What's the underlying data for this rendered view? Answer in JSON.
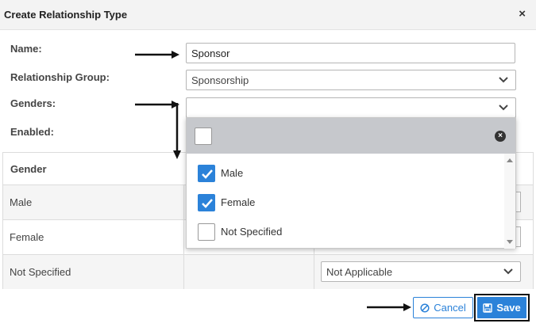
{
  "dialog": {
    "title": "Create Relationship Type",
    "close_symbol": "×"
  },
  "form": {
    "name_label": "Name:",
    "name_value": "Sponsor",
    "group_label": "Relationship Group:",
    "group_value": "Sponsorship",
    "genders_label": "Genders:",
    "genders_value": "",
    "enabled_label": "Enabled:"
  },
  "grid": {
    "header": "Gender",
    "rows": [
      {
        "gender": "Male"
      },
      {
        "gender": "Female"
      },
      {
        "gender": "Not Specified",
        "value": "Not Applicable"
      }
    ]
  },
  "dropdown": {
    "items": [
      {
        "label": "Male",
        "checked": true
      },
      {
        "label": "Female",
        "checked": true
      },
      {
        "label": "Not Specified",
        "checked": false
      }
    ]
  },
  "buttons": {
    "cancel_label": "Cancel",
    "save_label": "Save"
  },
  "icons": {
    "cancel": "ban-icon",
    "save": "floppy-disk-icon",
    "clear": "circle-x-icon",
    "chevron": "chevron-down-icon"
  },
  "colors": {
    "accent": "#2b82d9",
    "dropdown_header": "#c6c8cc"
  }
}
